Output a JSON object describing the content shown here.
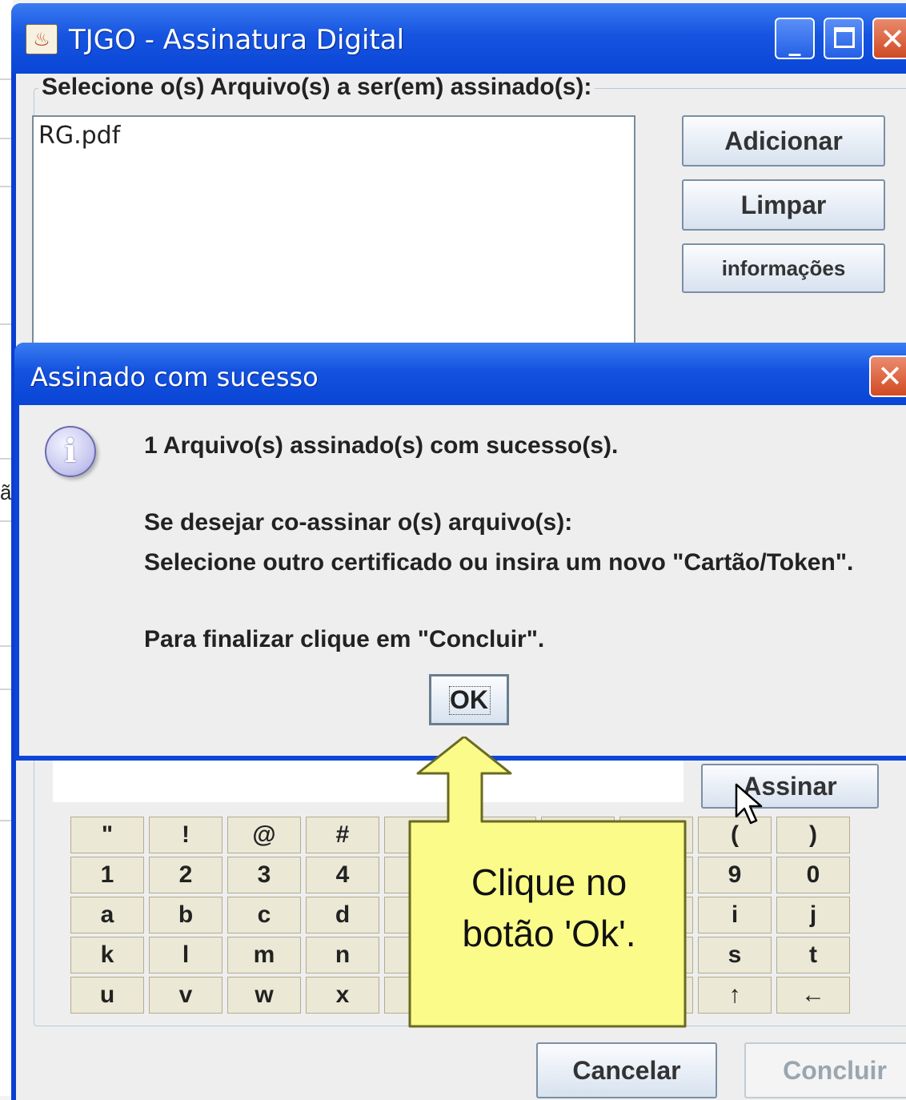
{
  "main_window": {
    "title": "TJGO - Assinatura Digital",
    "title_icon": "java-icon",
    "controls": {
      "minimize": "_",
      "close": "✕"
    },
    "group_label": "Selecione o(s) Arquivo(s) a ser(em) assinado(s):",
    "files": [
      "RG.pdf"
    ],
    "buttons": {
      "add": "Adicionar",
      "clear": "Limpar",
      "info": "informações",
      "sign": "Assinar",
      "cancel": "Cancelar",
      "conclude": "Concluir"
    },
    "keyboard": {
      "rows": [
        [
          "\"",
          "!",
          "@",
          "#",
          "",
          "",
          "",
          "",
          "(",
          ")"
        ],
        [
          "1",
          "2",
          "3",
          "4",
          "",
          "",
          "",
          "",
          "9",
          "0"
        ],
        [
          "a",
          "b",
          "c",
          "d",
          "",
          "",
          "",
          "",
          "i",
          "j"
        ],
        [
          "k",
          "l",
          "m",
          "n",
          "",
          "",
          "",
          "",
          "s",
          "t"
        ],
        [
          "u",
          "v",
          "w",
          "x",
          "",
          "",
          "",
          "",
          "↑",
          "←"
        ]
      ]
    }
  },
  "dialog": {
    "title": "Assinado com sucesso",
    "close": "✕",
    "icon": "info-icon",
    "icon_glyph": "i",
    "message_line1": "1 Arquivo(s) assinado(s) com sucesso(s).",
    "message_line2": "Se desejar co-assinar o(s) arquivo(s):",
    "message_line3": "Selecione outro certificado ou insira um novo \"Cartão/Token\".",
    "message_line4": "Para finalizar clique em \"Concluir\".",
    "ok_label": "OK"
  },
  "callout": {
    "text_line1": "Clique no",
    "text_line2": "botão 'Ok'.",
    "color": "#fbfb8a"
  },
  "background": {
    "char": "ã"
  }
}
